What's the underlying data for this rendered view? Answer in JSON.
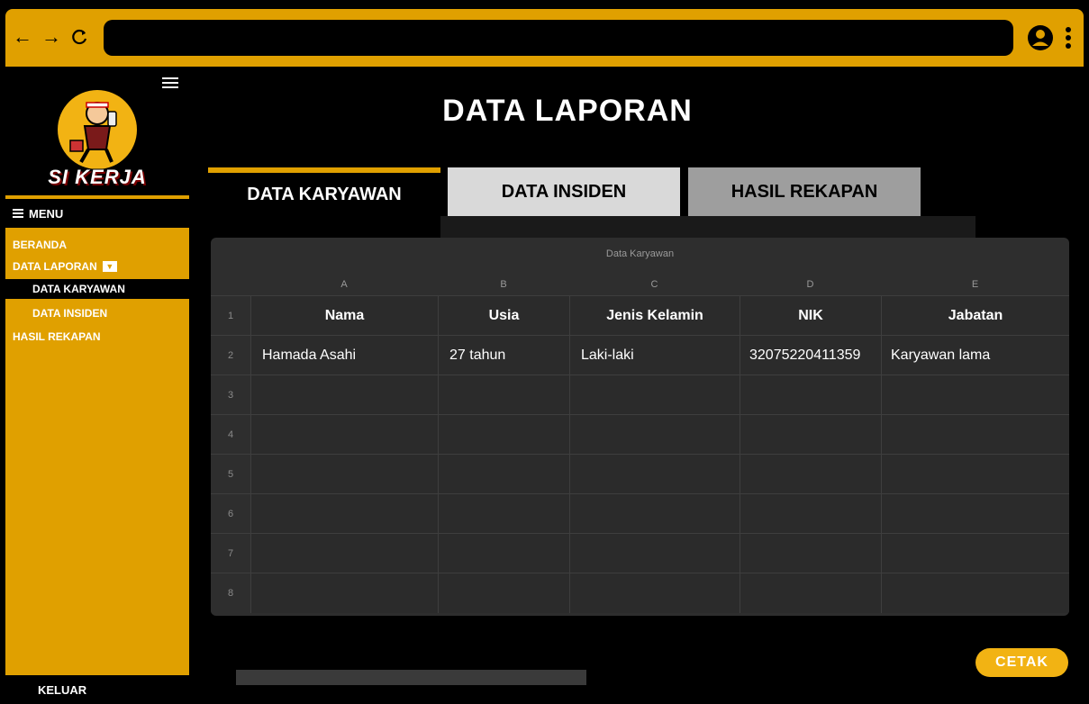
{
  "browser": {
    "back_icon": "←",
    "forward_icon": "→",
    "reload_icon": "C"
  },
  "sidebar": {
    "logo_text": "SI KERJA",
    "menu_label": "MENU",
    "items": [
      {
        "label": "BERANDA"
      },
      {
        "label": "DATA LAPORAN"
      },
      {
        "label": "DATA KARYAWAN"
      },
      {
        "label": "DATA INSIDEN"
      },
      {
        "label": "HASIL REKAPAN"
      }
    ],
    "logout_label": "KELUAR"
  },
  "main": {
    "title": "DATA LAPORAN",
    "tabs": [
      {
        "label": "DATA KARYAWAN"
      },
      {
        "label": "DATA INSIDEN"
      },
      {
        "label": "HASIL REKAPAN"
      }
    ]
  },
  "sheet": {
    "title": "Data Karyawan",
    "columns": [
      "A",
      "B",
      "C",
      "D",
      "E"
    ],
    "row_numbers": [
      "1",
      "2",
      "3",
      "4",
      "5",
      "6",
      "7",
      "8"
    ],
    "headers": [
      "Nama",
      "Usia",
      "Jenis Kelamin",
      "NIK",
      "Jabatan"
    ],
    "rows": [
      [
        "Hamada Asahi",
        "27 tahun",
        "Laki-laki",
        "32075220411359",
        "Karyawan lama"
      ]
    ]
  },
  "actions": {
    "print_label": "CETAK"
  },
  "colors": {
    "accent": "#E0A000",
    "accent_light": "#F2B313",
    "background": "#000000",
    "sheet": "#2E2E2E"
  }
}
